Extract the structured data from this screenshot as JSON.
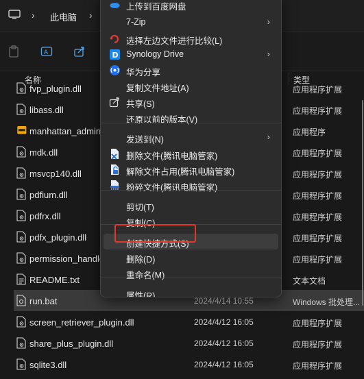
{
  "address": {
    "location": "此电脑"
  },
  "header": {
    "name_col": "名称",
    "type_col": "类型"
  },
  "files": [
    {
      "name": "fvp_plugin.dll",
      "date": "",
      "type": "应用程序扩展",
      "icon": "dll-file-icon"
    },
    {
      "name": "libass.dll",
      "date": "",
      "type": "应用程序扩展",
      "icon": "dll-file-icon"
    },
    {
      "name": "manhattan_admin",
      "date": "",
      "type": "应用程序",
      "icon": "app-exe-icon"
    },
    {
      "name": "mdk.dll",
      "date": "",
      "type": "应用程序扩展",
      "icon": "dll-file-icon"
    },
    {
      "name": "msvcp140.dll",
      "date": "",
      "type": "应用程序扩展",
      "icon": "dll-file-icon"
    },
    {
      "name": "pdfium.dll",
      "date": "",
      "type": "应用程序扩展",
      "icon": "dll-file-icon"
    },
    {
      "name": "pdfrx.dll",
      "date": "",
      "type": "应用程序扩展",
      "icon": "dll-file-icon"
    },
    {
      "name": "pdfx_plugin.dll",
      "date": "",
      "type": "应用程序扩展",
      "icon": "dll-file-icon"
    },
    {
      "name": "permission_handle",
      "date": "",
      "type": "应用程序扩展",
      "icon": "dll-file-icon"
    },
    {
      "name": "README.txt",
      "date": "",
      "type": "文本文档",
      "icon": "text-file-icon"
    },
    {
      "name": "run.bat",
      "date": "2024/4/14 10:55",
      "type": "Windows 批处理...",
      "icon": "bat-file-icon"
    },
    {
      "name": "screen_retriever_plugin.dll",
      "date": "2024/4/12 16:05",
      "type": "应用程序扩展",
      "icon": "dll-file-icon"
    },
    {
      "name": "share_plus_plugin.dll",
      "date": "2024/4/12 16:05",
      "type": "应用程序扩展",
      "icon": "dll-file-icon"
    },
    {
      "name": "sqlite3.dll",
      "date": "2024/4/12 16:05",
      "type": "应用程序扩展",
      "icon": "dll-file-icon"
    }
  ],
  "menu": {
    "items": [
      {
        "label": "上传到百度网盘",
        "icon": "baidu-cloud-icon",
        "submenu": false
      },
      {
        "label": "7-Zip",
        "icon": "",
        "submenu": true
      },
      {
        "label": "选择左边文件进行比较(L)",
        "icon": "compare-icon",
        "submenu": false
      },
      {
        "label": "Synology Drive",
        "icon": "synology-drive-icon",
        "submenu": true
      },
      {
        "label": "华为分享",
        "icon": "huawei-share-icon",
        "submenu": false
      },
      {
        "label": "复制文件地址(A)",
        "icon": "",
        "submenu": false
      },
      {
        "label": "共享(S)",
        "icon": "share-icon",
        "submenu": false
      },
      {
        "label": "还原以前的版本(V)",
        "icon": "",
        "submenu": false
      },
      {
        "label": "发送到(N)",
        "icon": "",
        "submenu": true
      },
      {
        "label": "删除文件(腾讯电脑管家)",
        "icon": "tencent-delete-icon",
        "submenu": false
      },
      {
        "label": "解除文件占用(腾讯电脑管家)",
        "icon": "tencent-unlock-icon",
        "submenu": false
      },
      {
        "label": "粉碎文件(腾讯电脑管家)",
        "icon": "tencent-shred-icon",
        "submenu": false
      },
      {
        "label": "剪切(T)",
        "icon": "",
        "submenu": false
      },
      {
        "label": "复制(C)",
        "icon": "",
        "submenu": false
      },
      {
        "label": "创建快捷方式(S)",
        "icon": "",
        "submenu": false
      },
      {
        "label": "删除(D)",
        "icon": "",
        "submenu": false
      },
      {
        "label": "重命名(M)",
        "icon": "",
        "submenu": false
      },
      {
        "label": "属性(R)",
        "icon": "",
        "submenu": false
      }
    ]
  },
  "colors": {
    "accent_red": "#e03a2e",
    "menu_bg": "#2c2c2c",
    "selected_row": "#3a3a3a"
  }
}
